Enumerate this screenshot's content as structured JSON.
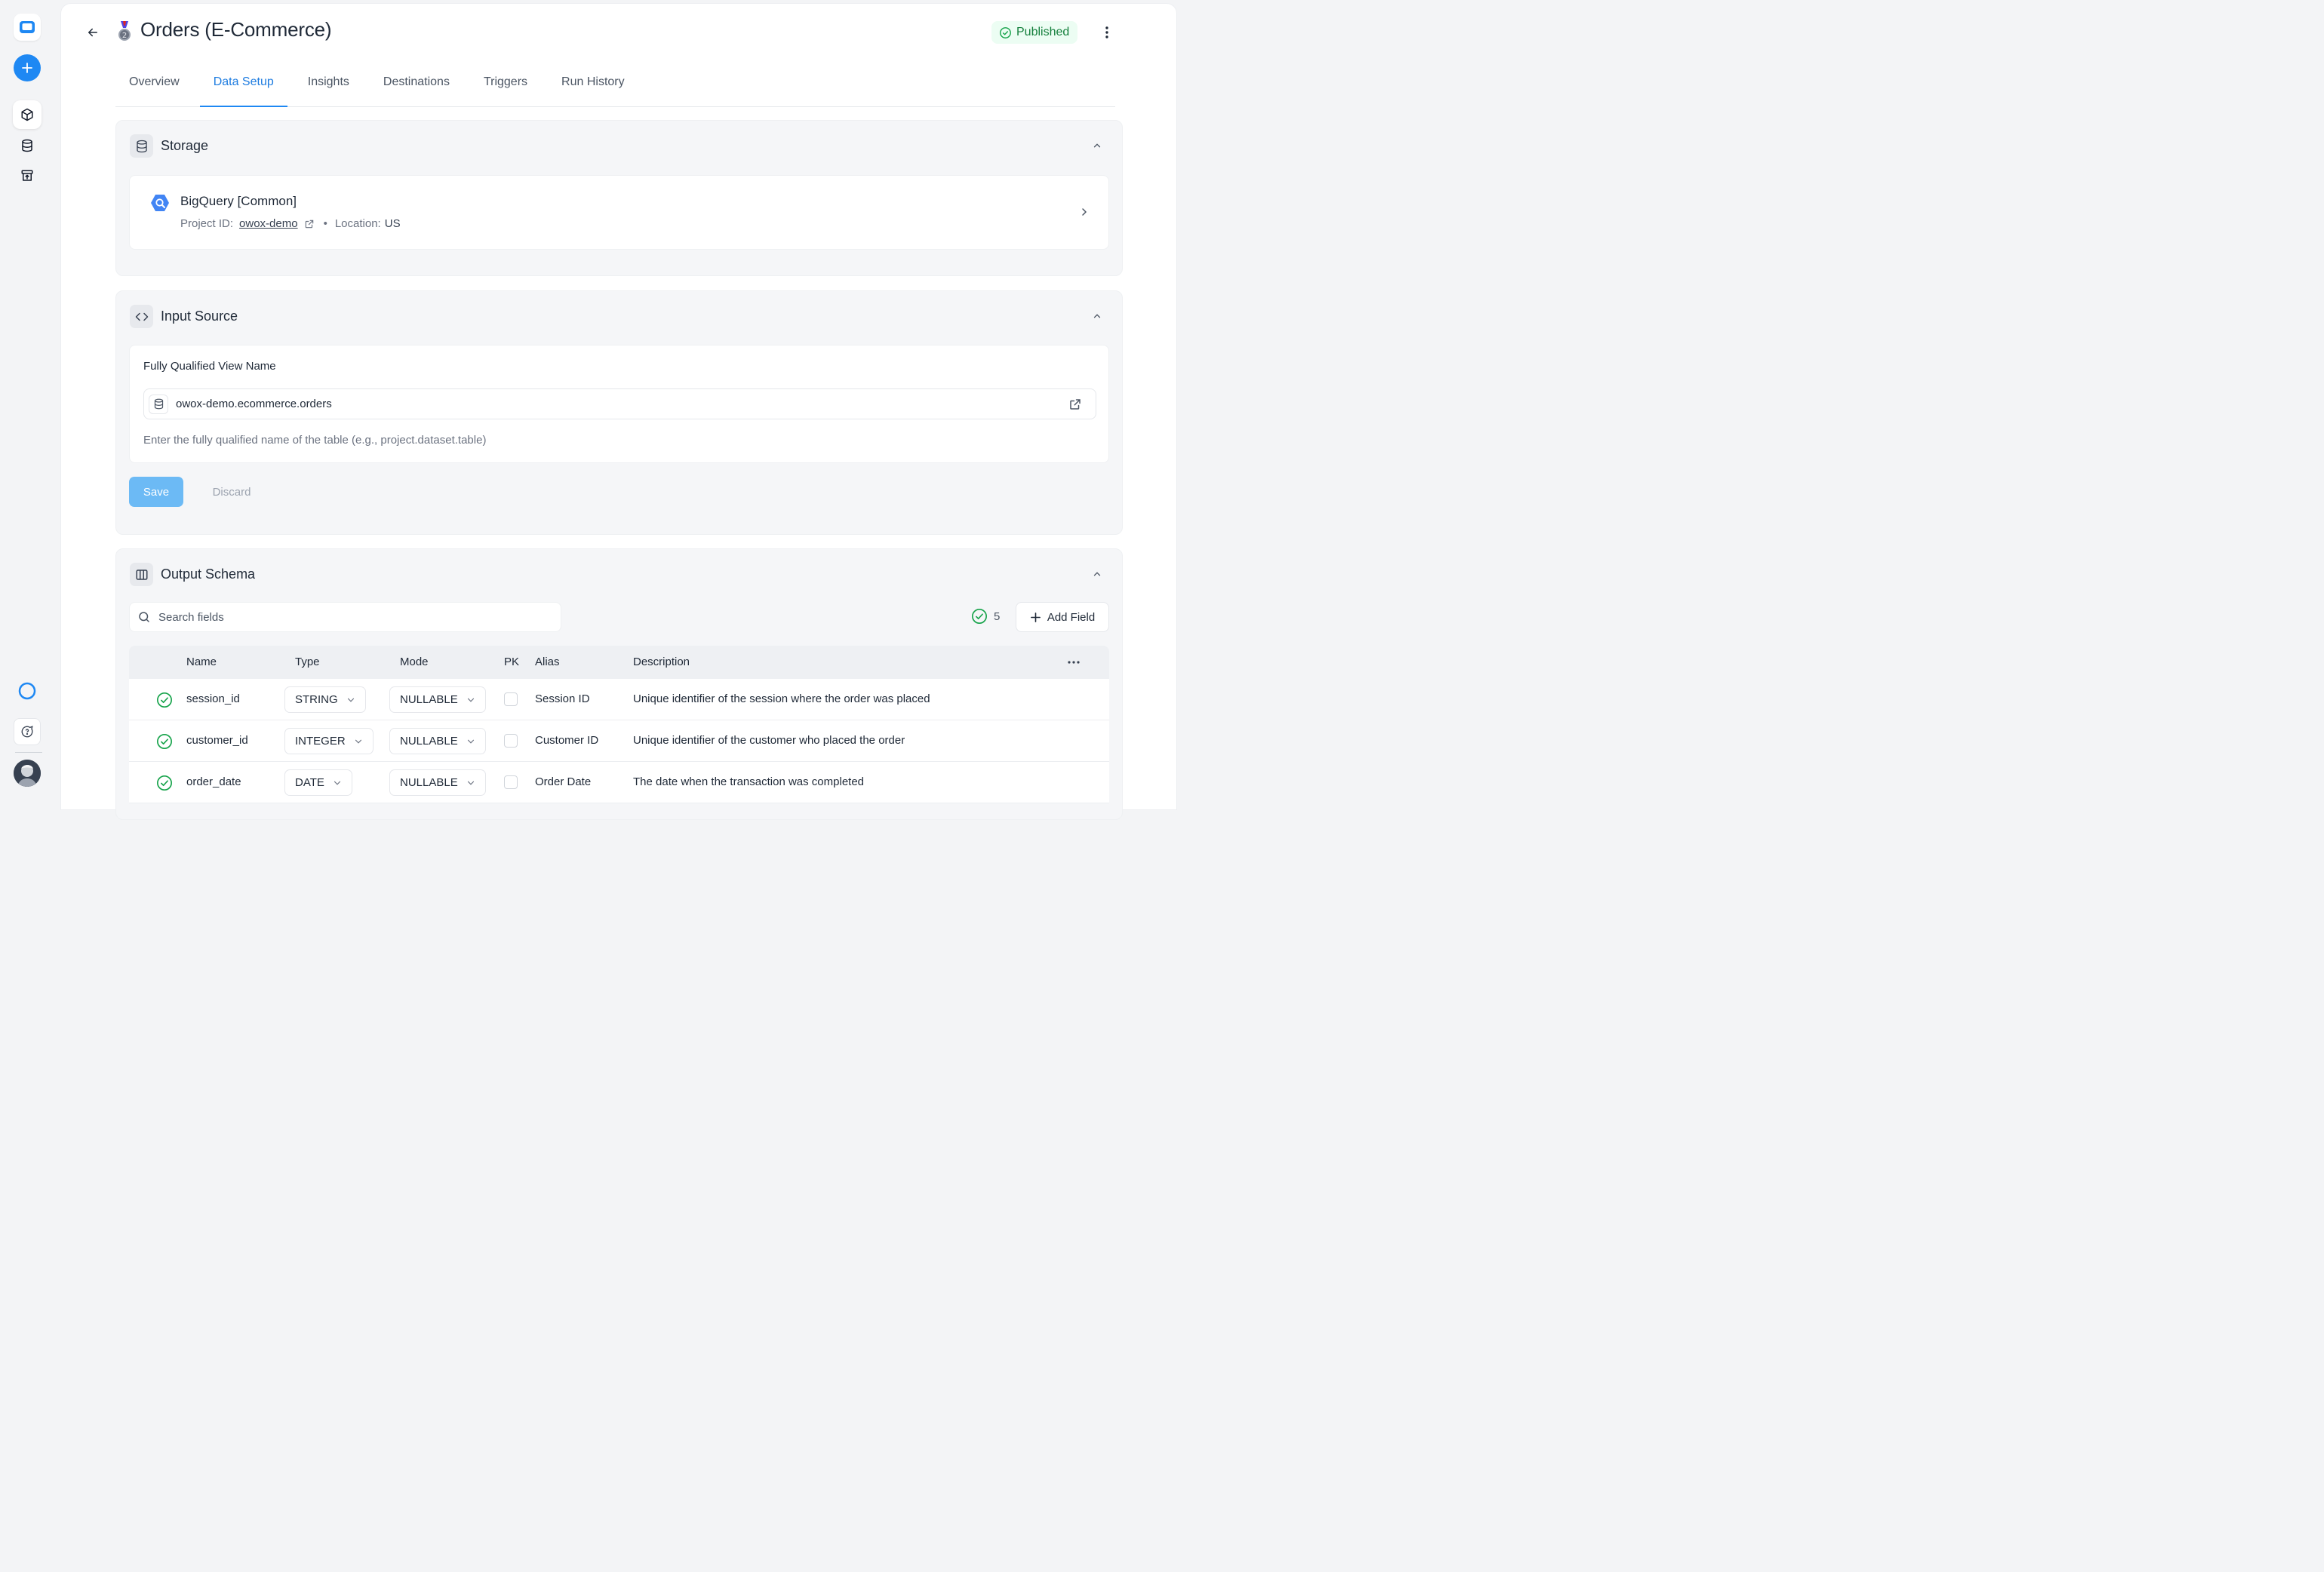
{
  "page": {
    "title": "Orders (E-Commerce)",
    "status": "Published"
  },
  "tabs": [
    {
      "label": "Overview",
      "active": false
    },
    {
      "label": "Data Setup",
      "active": true
    },
    {
      "label": "Insights",
      "active": false
    },
    {
      "label": "Destinations",
      "active": false
    },
    {
      "label": "Triggers",
      "active": false
    },
    {
      "label": "Run History",
      "active": false
    }
  ],
  "storage": {
    "title": "Storage",
    "name": "BigQuery [Common]",
    "project_label": "Project ID:",
    "project_id": "owox-demo",
    "location_label": "Location:",
    "location": "US"
  },
  "input_source": {
    "title": "Input Source",
    "field_label": "Fully Qualified View Name",
    "value": "owox-demo.ecommerce.orders",
    "helper": "Enter the fully qualified name of the table (e.g., project.dataset.table)",
    "save_label": "Save",
    "discard_label": "Discard"
  },
  "output_schema": {
    "title": "Output Schema",
    "search_placeholder": "Search fields",
    "valid_count": "5",
    "add_field_label": "Add Field",
    "columns": [
      "Name",
      "Type",
      "Mode",
      "PK",
      "Alias",
      "Description"
    ],
    "rows": [
      {
        "name": "session_id",
        "type": "STRING",
        "mode": "NULLABLE",
        "alias": "Session ID",
        "description": "Unique identifier of the session where the order was placed"
      },
      {
        "name": "customer_id",
        "type": "INTEGER",
        "mode": "NULLABLE",
        "alias": "Customer ID",
        "description": "Unique identifier of the customer who placed the order"
      },
      {
        "name": "order_date",
        "type": "DATE",
        "mode": "NULLABLE",
        "alias": "Order Date",
        "description": "The date when the transaction was completed"
      }
    ]
  },
  "colors": {
    "accent": "#1e88f3",
    "success": "#16a34a",
    "published_bg": "#ecfdf3"
  }
}
